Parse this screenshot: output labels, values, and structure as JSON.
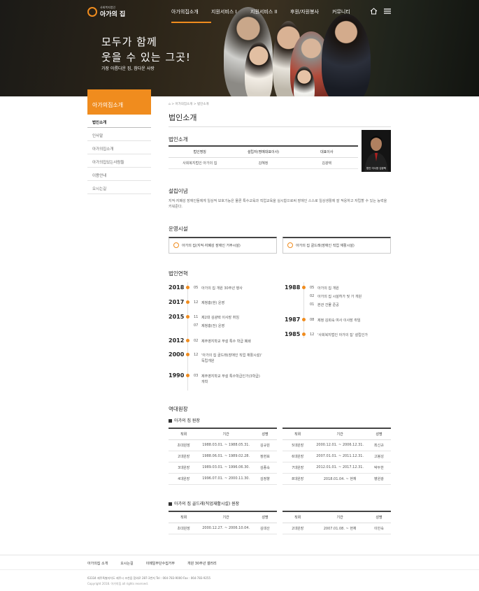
{
  "header": {
    "logo_small": "사회복지법인",
    "logo_text": "아가의 집",
    "menu": [
      "아가의집소개",
      "지원서비스 I",
      "지원서비스 II",
      "후원/자원봉사",
      "커뮤니티"
    ],
    "active_menu": 0,
    "slogan_line1": "모두가 함께",
    "slogan_line2": "웃을 수 있는 그곳!",
    "slogan_sub": "가장 아름다운 집, 참다운 사랑"
  },
  "sidebar": {
    "title": "아가의집소개",
    "items": [
      "법인소개",
      "인사말",
      "아가의집소개",
      "아가의집있는사람들",
      "이용안내",
      "오시는길"
    ],
    "active": 0
  },
  "main": {
    "breadcrumb": "⌂ > 아가의집소개 > 법인소개",
    "page_title": "법인소개",
    "intro": {
      "heading": "법인소개",
      "headers": [
        "법인명칭",
        "설립자(명예대표이사)",
        "대표이사"
      ],
      "row": [
        "사회복지법인 아가의 집",
        "김혜정",
        "김광택"
      ],
      "photo_caption": "법인 이사장 김광택"
    },
    "philosophy": {
      "heading": "설립이념",
      "text": "지적·자폐성 장애인들에게 일상적 보호기능은 물론 특수교육과 직업교육을 실시함으로써 장애인 스스로 일상생활에 잘 적응하고 자립할 수 있는 능력을 키워준다."
    },
    "facilities": {
      "heading": "운영시설",
      "items": [
        "아가의 집(지적·자폐성 장애인 거주시설)",
        "아가의 집 골드래(장애인 직업 재활시설)"
      ]
    },
    "history": {
      "heading": "법인연혁",
      "left": [
        {
          "year": "2018",
          "entries": [
            {
              "m": "05",
              "t": "아가의 집 개원 30주년 행사"
            }
          ]
        },
        {
          "year": "2017",
          "entries": [
            {
              "m": "12",
              "t": "제청홍(현) 운영"
            }
          ]
        },
        {
          "year": "2015",
          "entries": [
            {
              "m": "11",
              "t": "제2대 김광택 이사장 취임"
            },
            {
              "m": "07",
              "t": "제청홍(전) 운영"
            }
          ]
        },
        {
          "year": "2012",
          "entries": [
            {
              "m": "02",
              "t": "제주영지학교 부설 특수 학급 폐쇄"
            }
          ]
        },
        {
          "year": "2000",
          "entries": [
            {
              "m": "12",
              "t": "'아가의 집 골드래(장애인 직업 재활시설)'"
            },
            {
              "m": "",
              "t": "독립개원"
            }
          ]
        },
        {
          "year": "1990",
          "entries": [
            {
              "m": "03",
              "t": "제주영지학교 부설 특수학급인가(3학급)"
            },
            {
              "m": "",
              "t": "개학"
            }
          ]
        }
      ],
      "right": [
        {
          "year": "1988",
          "entries": [
            {
              "m": "05",
              "t": "아가의 집 개원"
            },
            {
              "m": "02",
              "t": "아가의 집 시설허가 및 가 개원"
            },
            {
              "m": "01",
              "t": "본관 건물 준공"
            }
          ]
        },
        {
          "year": "1987",
          "entries": [
            {
              "m": "08",
              "t": "제정 김희숙 여사 이사장 취임"
            }
          ]
        },
        {
          "year": "1985",
          "entries": [
            {
              "m": "12",
              "t": "'사회복지법인 아가의 집' 설립인가"
            }
          ]
        }
      ]
    },
    "directors": {
      "heading": "역대원장",
      "sub1": "아가의 집 원장",
      "sub2": "아가의 집 골드래(직업재활시설) 원장",
      "headers": [
        "직위",
        "기간",
        "성명"
      ],
      "table1_left": [
        [
          "초대원장",
          "1988.03.01. ~ 1988.05.31.",
          "김규원"
        ],
        [
          "2대원장",
          "1988.06.01. ~ 1989.02.28.",
          "정현표"
        ],
        [
          "3대원장",
          "1989.03.01. ~ 1996.06.30.",
          "김종숙"
        ],
        [
          "4대원장",
          "1996.07.01. ~ 2000.11.30.",
          "김정향"
        ]
      ],
      "table1_right": [
        [
          "5대원장",
          "2000.12.01. ~ 2006.12.31.",
          "최신규"
        ],
        [
          "6대원장",
          "2007.01.01. ~ 2011.12.31.",
          "고봉성"
        ],
        [
          "7대원장",
          "2012.01.01. ~ 2017.12.31.",
          "박두한"
        ],
        [
          "8대원장",
          "2018.01.04. ~ 현재",
          "병원광"
        ]
      ],
      "table2_left": [
        [
          "초대원장",
          "2000.12.27. ~ 2006.10.04.",
          "김대산"
        ]
      ],
      "table2_right": [
        [
          "2대원장",
          "2007.01.08. ~ 현재",
          "이민숙"
        ]
      ]
    }
  },
  "footer": {
    "links": [
      "아가의집 소개",
      "오시는길",
      "이메일무단수집거부",
      "개원 30주년 갤러리"
    ],
    "address": "63334 제주특별자치도 제주시 조천읍 함와로 287-3번지    Tel : 064-783-9000    Fax : 064-783-9255",
    "copyright": "Copyright 2018. 아가의집 all rights reserved."
  },
  "colors": {
    "accent": "#f08c1e",
    "dark": "#222222"
  }
}
